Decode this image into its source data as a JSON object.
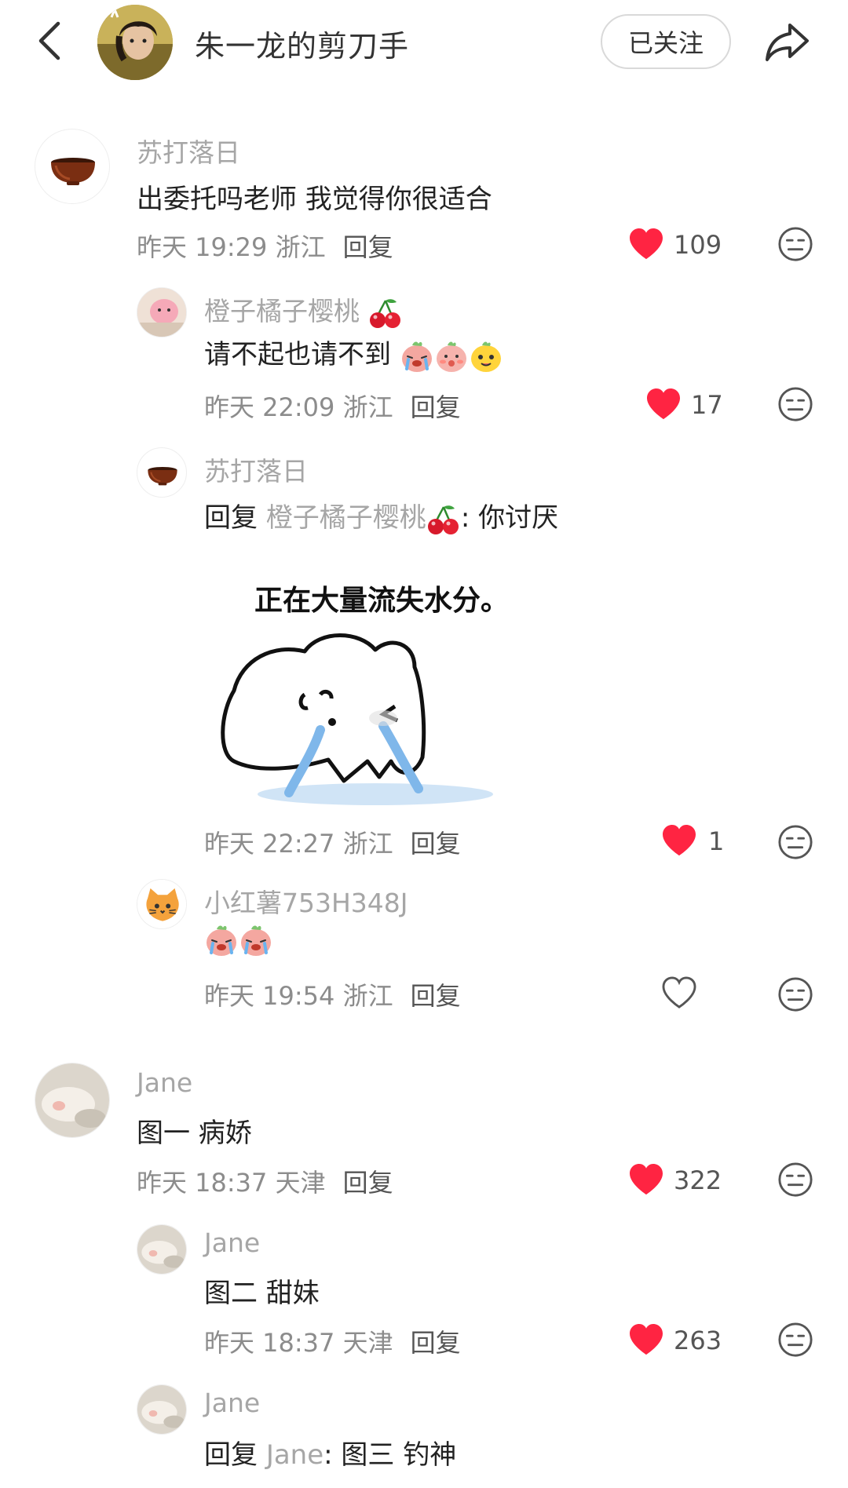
{
  "header": {
    "title": "朱一龙的剪刀手",
    "follow_label": "已关注"
  },
  "comments": [
    {
      "name": "苏打落日",
      "text": "出委托吗老师 我觉得你很适合",
      "time": "昨天 19:29 浙江",
      "reply": "回复",
      "likes": "109",
      "liked": true
    },
    {
      "name": "橙子橘子樱桃",
      "text": "请不起也请不到",
      "time": "昨天 22:09 浙江",
      "reply": "回复",
      "likes": "17",
      "liked": true,
      "emojis": [
        "crying-face-emoji",
        "shy-face-emoji",
        "yellow-face-emoji"
      ]
    },
    {
      "name": "苏打落日",
      "reply_prefix": "回复",
      "reply_to": "橙子橘子樱桃",
      "text": ": 你讨厌",
      "sticker_caption": "正在大量流失水分。",
      "time": "昨天 22:27 浙江",
      "reply": "回复",
      "likes": "1",
      "liked": true
    },
    {
      "name": "小红薯753H348J",
      "time": "昨天 19:54 浙江",
      "reply": "回复",
      "likes": "",
      "liked": false,
      "emojis": [
        "crying-face-emoji",
        "crying-face-emoji"
      ]
    },
    {
      "name": "Jane",
      "text": "图一 病娇",
      "time": "昨天 18:37 天津",
      "reply": "回复",
      "likes": "322",
      "liked": true
    },
    {
      "name": "Jane",
      "text": "图二 甜妹",
      "time": "昨天 18:37 天津",
      "reply": "回复",
      "likes": "263",
      "liked": true
    },
    {
      "name": "Jane",
      "reply_prefix": "回复",
      "reply_to": "Jane",
      "text": ": 图三 钓神"
    }
  ],
  "colors": {
    "like_red": "#ff2442",
    "text_primary": "#222222",
    "text_secondary": "#a6a6a6"
  },
  "icons": {
    "back": "chevron-left-icon",
    "share": "share-arrow-icon",
    "like": "heart-icon",
    "dislike": "meh-face-icon",
    "cherry": "cherry-icon"
  }
}
